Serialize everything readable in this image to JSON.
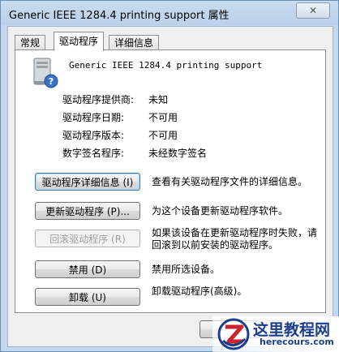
{
  "window": {
    "title": "Generic IEEE 1284.4 printing support 属性",
    "close_glyph": "✕"
  },
  "tabs": [
    {
      "label": "常规"
    },
    {
      "label": "驱动程序"
    },
    {
      "label": "详细信息"
    }
  ],
  "device": {
    "name": "Generic IEEE 1284.4 printing support",
    "icon": "device-help-icon"
  },
  "info": [
    {
      "key": "驱动程序提供商:",
      "value": "未知"
    },
    {
      "key": "驱动程序日期:",
      "value": "不可用"
    },
    {
      "key": "驱动程序版本:",
      "value": "不可用"
    },
    {
      "key": "数字签名程序:",
      "value": "未经数字签名"
    }
  ],
  "actions": [
    {
      "label": "驱动程序详细信息 (I)",
      "desc": "查看有关驱动程序文件的详细信息。"
    },
    {
      "label": "更新驱动程序 (P)...",
      "desc": "为这个设备更新驱动程序软件。"
    },
    {
      "label": "回滚驱动程序 (R)",
      "desc": "如果该设备在更新驱动程序时失败，请回滚到以前安装的驱动程序。"
    },
    {
      "label": "禁用 (D)",
      "desc": "禁用所选设备。"
    },
    {
      "label": "卸载 (U)",
      "desc": "卸载驱动程序(高级)。"
    }
  ],
  "watermark": {
    "title": "这里教程网",
    "url": "herecours.com"
  }
}
